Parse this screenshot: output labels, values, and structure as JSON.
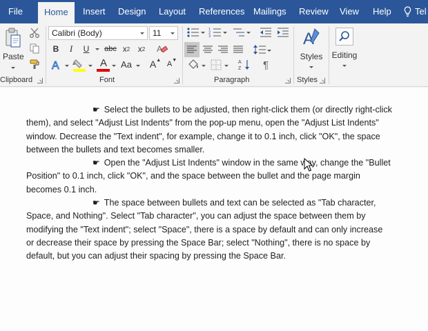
{
  "tabs": [
    {
      "label": "File",
      "active": false
    },
    {
      "label": "Home",
      "active": true
    },
    {
      "label": "Insert",
      "active": false
    },
    {
      "label": "Design",
      "active": false
    },
    {
      "label": "Layout",
      "active": false
    },
    {
      "label": "References",
      "active": false
    },
    {
      "label": "Mailings",
      "active": false
    },
    {
      "label": "Review",
      "active": false
    },
    {
      "label": "View",
      "active": false
    },
    {
      "label": "Help",
      "active": false
    },
    {
      "label": "Tel",
      "active": false
    }
  ],
  "ribbon": {
    "clipboard": {
      "label": "Clipboard",
      "paste_label": "Paste"
    },
    "font": {
      "label": "Font",
      "font_name": "Calibri (Body)",
      "font_size": "11",
      "bold": "B",
      "italic": "I",
      "underline": "U",
      "strike": "abc",
      "subscript": "x",
      "subscript_mark": "2",
      "superscript": "x",
      "superscript_mark": "2",
      "font_color_letter": "A",
      "change_case": "Aa",
      "grow": "A",
      "shrink": "A",
      "highlight_color": "#ffff00",
      "font_color": "#e00000"
    },
    "paragraph": {
      "label": "Paragraph",
      "pilcrow": "¶"
    },
    "styles": {
      "label": "Styles",
      "button_label": "Styles"
    },
    "editing": {
      "button_label": "Editing"
    }
  },
  "document": {
    "paragraphs": [
      "Select the bullets to be adjusted, then right-click them (or directly right-click them), and select \"Adjust List Indents\" from the pop-up menu, open the \"Adjust List Indents\" window. Decrease the \"Text indent\", for example, change it to 0.1 inch, click \"OK\", the space between the bullets and text becomes smaller.",
      "Open the \"Adjust List Indents\" window in the same way, change the \"Bullet Position\" to 0.1 inch, click \"OK\", and the space between the bullet and the page margin becomes 0.1 inch.",
      "The space between bullets and text can be selected as \"Tab character, Space, and Nothing\". Select \"Tab character\", you can adjust the space between them by modifying the \"Text indent\"; select \"Space\", there is a space by default and can only increase or decrease their space by pressing the Space Bar; select \"Nothing\", there is no space by default, but you can adjust their spacing by pressing the Space Bar."
    ],
    "bullet_glyph": "☛"
  },
  "colors": {
    "accent": "#2b579a",
    "ribbon_bg": "#f3f3f3",
    "page_bg": "#fdfdfe"
  }
}
